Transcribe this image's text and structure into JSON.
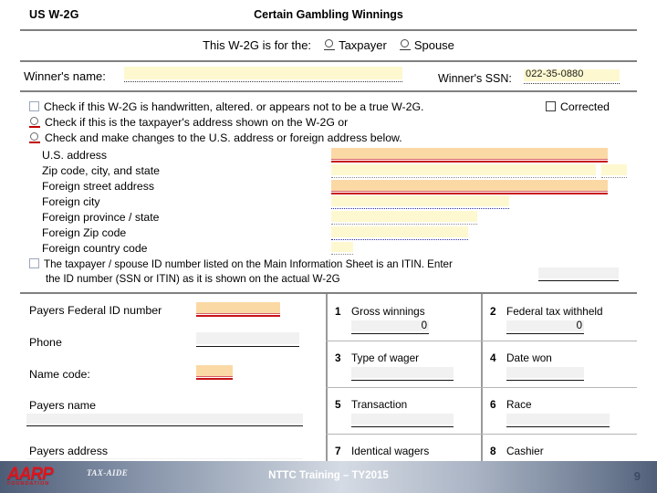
{
  "form": {
    "title_left": "US W-2G",
    "title_center": "Certain Gambling Winnings",
    "for_the_label": "This W-2G is for the:",
    "for_the_options": [
      "Taxpayer",
      "Spouse"
    ],
    "winner_name_label": "Winner's name:",
    "winner_name_value": "",
    "winner_ssn_label": "Winner's SSN:",
    "winner_ssn_value": "022-35-0880",
    "corrected_label": "Corrected",
    "checks": [
      "Check if this W-2G is handwritten, altered.  or appears not to be a true W-2G.",
      "Check if this is the taxpayer's address shown on the W-2G   or",
      "Check and make changes to the U.S.  address or foreign address below."
    ],
    "address_rows": [
      {
        "label": "U.S.  address"
      },
      {
        "label": "Zip code,  city,  and state"
      },
      {
        "label": "Foreign street address"
      },
      {
        "label": "Foreign city"
      },
      {
        "label": "Foreign province / state"
      },
      {
        "label": "Foreign Zip code"
      },
      {
        "label": "Foreign country code"
      }
    ],
    "itin_line1": "The taxpayer / spouse ID number listed on the Main Information Sheet is an ITIN.  Enter",
    "itin_line2": "the ID number  (SSN or ITIN)  as it is shown on the actual W-2G",
    "payer": {
      "fed_id_label": "Payers Federal ID number",
      "phone_label": "Phone",
      "name_code_label": "Name code:",
      "payers_name_label": "Payers name",
      "payers_address_label": "Payers address"
    },
    "boxes": [
      {
        "num": "1",
        "label": "Gross winnings",
        "value": "0"
      },
      {
        "num": "2",
        "label": "Federal tax withheld",
        "value": "0"
      },
      {
        "num": "3",
        "label": "Type of wager",
        "value": ""
      },
      {
        "num": "4",
        "label": "Date won",
        "value": ""
      },
      {
        "num": "5",
        "label": "Transaction",
        "value": ""
      },
      {
        "num": "6",
        "label": "Race",
        "value": ""
      },
      {
        "num": "7",
        "label": "Identical wagers",
        "value": ""
      },
      {
        "num": "8",
        "label": "Cashier",
        "value": ""
      }
    ]
  },
  "footer": {
    "logo_word": "AARP",
    "logo_sub": "FOUNDATION",
    "tax_aide": "TAX-AIDE",
    "center_text": "NTTC Training – TY2015",
    "page_number": "9"
  },
  "colors": {
    "field_yellow": "#fdf8cf",
    "field_orange": "#fbd9a5",
    "field_gray": "#f1f1f1",
    "required_red": "#c81418",
    "brand_red": "#e2121a"
  }
}
